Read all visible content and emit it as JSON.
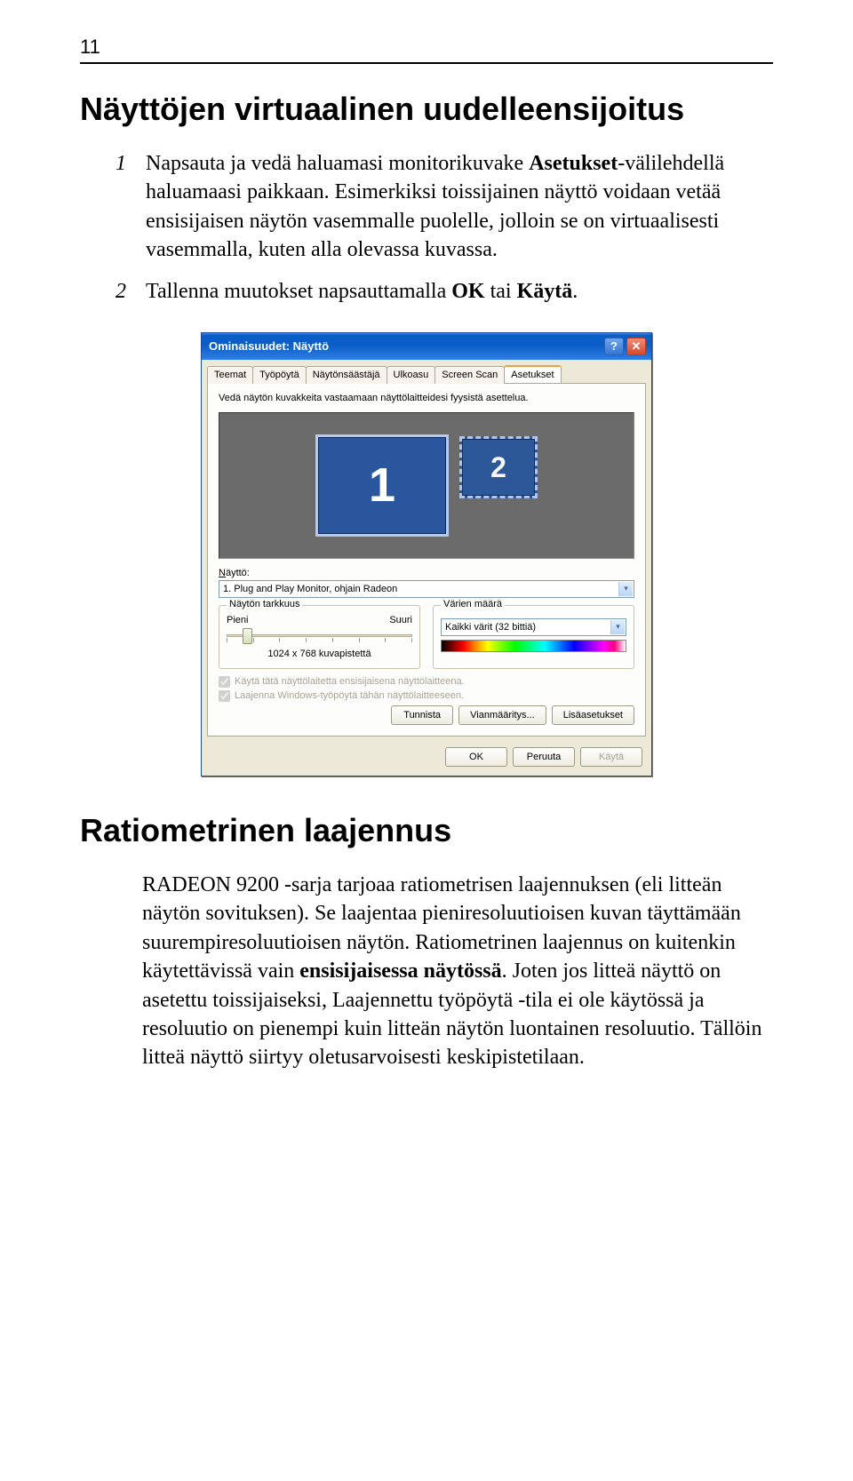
{
  "page_number": "11",
  "section1_title": "Näyttöjen virtuaalinen uudelleensijoitus",
  "steps": [
    {
      "num": "1",
      "pre": "Napsauta ja vedä haluamasi monitorikuvake ",
      "bold": "Asetukset",
      "post": "-välilehdellä haluamaasi paikkaan. Esimerkiksi toissijainen näyttö voidaan vetää ensisijaisen näytön vasemmalle puolelle, jolloin se on virtuaalisesti vasemmalla, kuten alla olevassa kuvassa."
    },
    {
      "num": "2",
      "pre": "Tallenna muutokset napsauttamalla ",
      "bold": "OK",
      "mid": " tai ",
      "bold2": "Käytä",
      "post": "."
    }
  ],
  "dialog": {
    "title": "Ominaisuudet: Näyttö",
    "tabs": [
      "Teemat",
      "Työpöytä",
      "Näytönsäästäjä",
      "Ulkoasu",
      "Screen Scan",
      "Asetukset"
    ],
    "active_tab_index": 5,
    "instruct": "Vedä näytön kuvakkeita vastaamaan näyttölaitteidesi fyysistä asettelua.",
    "mon1": "1",
    "mon2": "2",
    "display_label": "Näyttö:",
    "display_value": "1. Plug and Play Monitor, ohjain Radeon",
    "res_legend": "Näytön tarkkuus",
    "res_left": "Pieni",
    "res_right": "Suuri",
    "res_value": "1024 x 768 kuvapistettä",
    "color_legend": "Värien määrä",
    "color_value": "Kaikki värit (32 bittiä)",
    "check1": "Käytä tätä näyttölaitetta ensisijaisena näyttölaitteena.",
    "check2": "Laajenna Windows-työpöytä tähän näyttölaitteeseen.",
    "btn_identify": "Tunnista",
    "btn_trouble": "Vianmääritys...",
    "btn_advanced": "Lisäasetukset",
    "btn_ok": "OK",
    "btn_cancel": "Peruuta",
    "btn_apply": "Käytä"
  },
  "section2_title": "Ratiometrinen laajennus",
  "body_pre": "RADEON 9200 -sarja tarjoaa ratiometrisen laajennuksen (eli litteän näytön sovituksen). Se laajentaa pieniresoluutioisen kuvan täyttämään suurempiresoluutioisen näytön. Ratiometrinen laajennus on kuitenkin käytettävissä vain ",
  "body_bold": "ensisijaisessa näytössä",
  "body_post": ". Joten jos litteä näyttö on asetettu toissijaiseksi, Laajennettu työpöytä -tila ei ole käytössä ja resoluutio on pienempi kuin litteän näytön luontainen resoluutio. Tällöin litteä näyttö siirtyy oletusarvoisesti keskipistetilaan."
}
